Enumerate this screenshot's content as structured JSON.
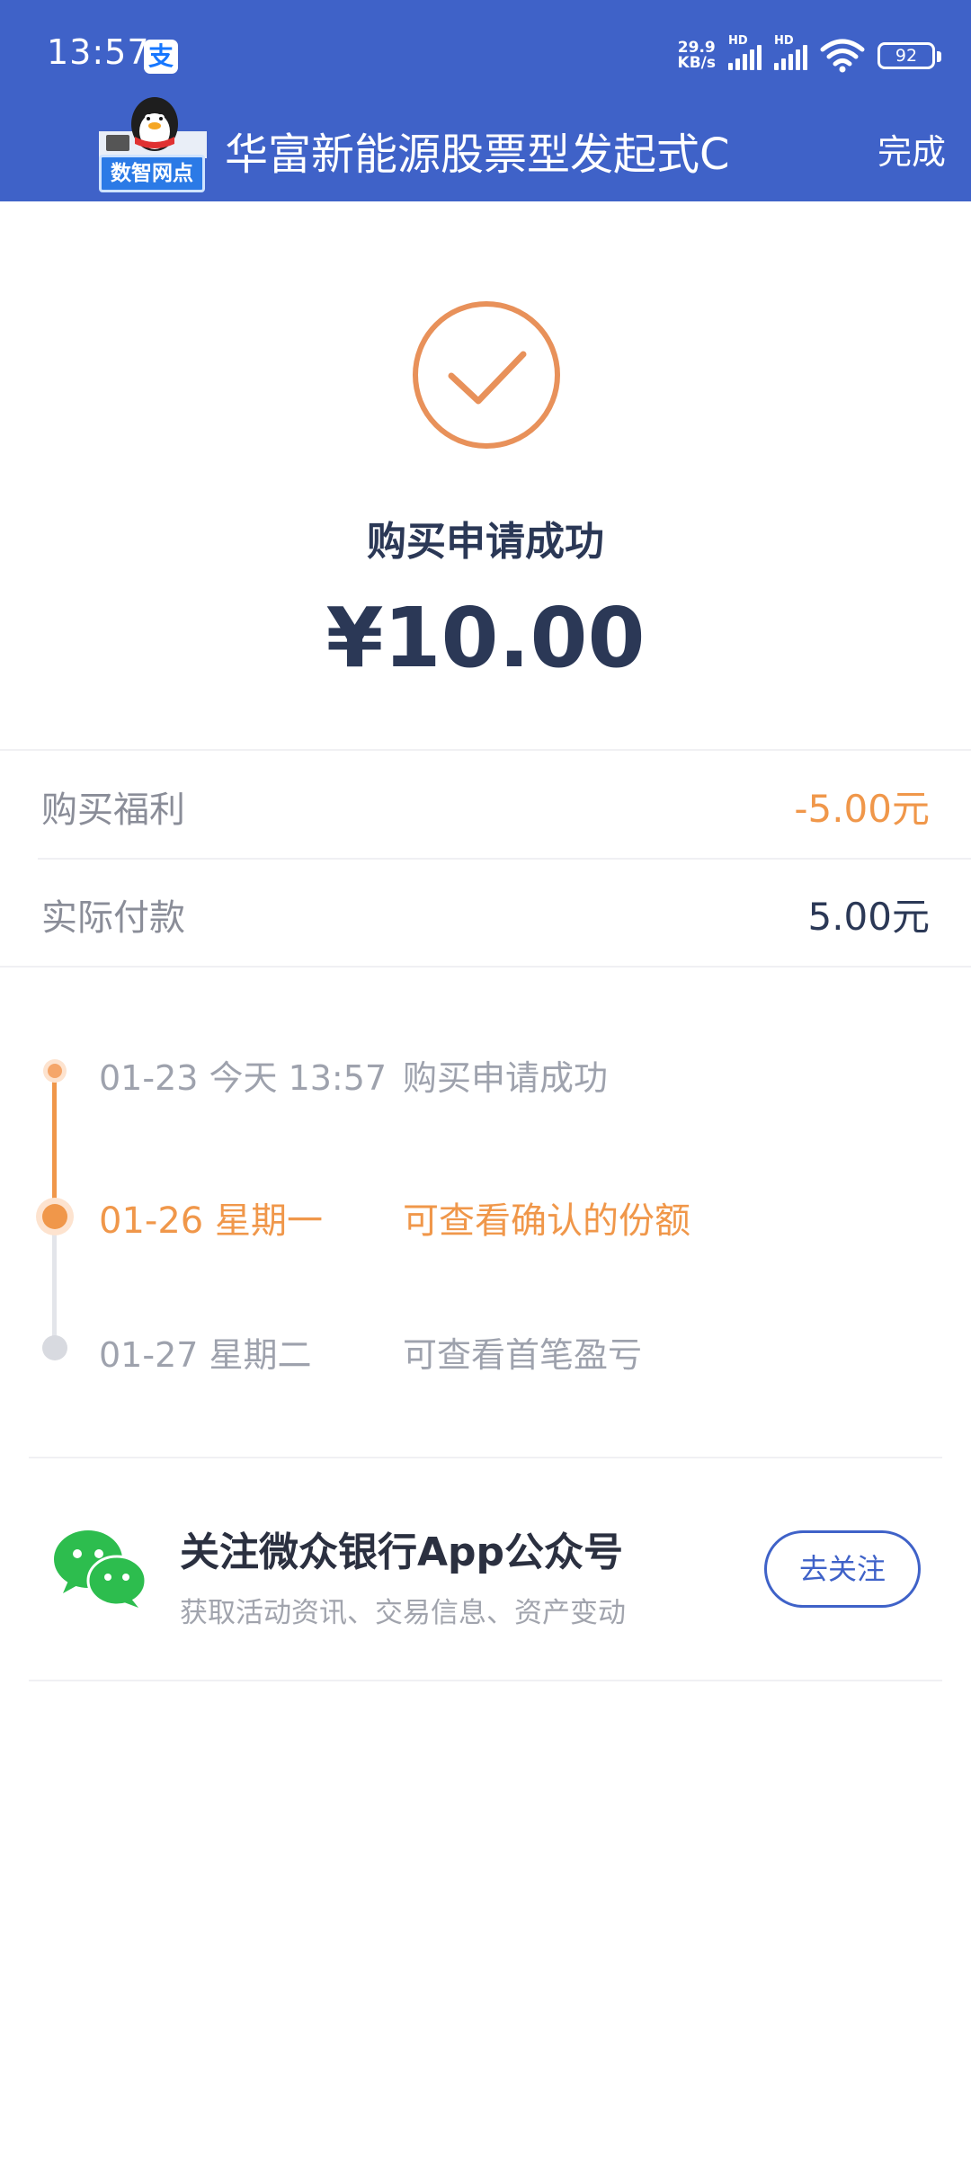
{
  "status_bar": {
    "time": "13:57",
    "app_badge": "支",
    "net_speed_value": "29.9",
    "net_speed_unit": "KB/s",
    "hd_1": "HD",
    "hd_2": "HD",
    "battery": "92"
  },
  "header": {
    "logo_text": "数智网点",
    "title": "华富新能源股票型发起式C",
    "done_label": "完成",
    "background": "#3f62c8"
  },
  "result": {
    "title": "购买申请成功",
    "amount": "¥10.00",
    "icon_color": "#e8915a"
  },
  "details": [
    {
      "label": "购买福利",
      "value": "-5.00元",
      "color": "#f0974a"
    },
    {
      "label": "实际付款",
      "value": "5.00元",
      "color": "#2b3856"
    }
  ],
  "timeline": [
    {
      "date": "01-23 今天 13:57",
      "desc": "购买申请成功",
      "state": "done"
    },
    {
      "date": "01-26 星期一",
      "desc": "可查看确认的份额",
      "state": "active"
    },
    {
      "date": "01-27 星期二",
      "desc": "可查看首笔盈亏",
      "state": "pending"
    }
  ],
  "follow": {
    "title": "关注微众银行App公众号",
    "subtitle": "获取活动资讯、交易信息、资产变动",
    "button_label": "去关注"
  }
}
